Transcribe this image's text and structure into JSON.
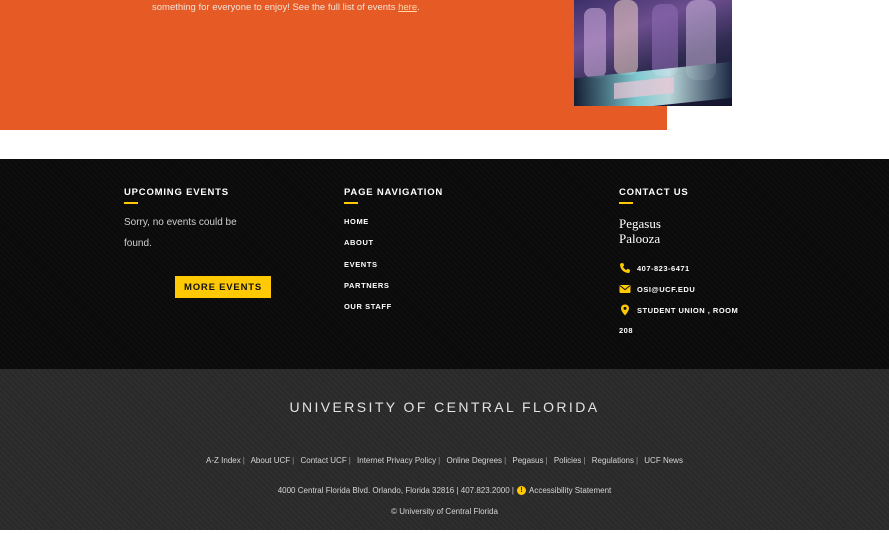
{
  "hero": {
    "text": "something for everyone to enjoy! See the full list of events ",
    "link_text": "here",
    "trailing": ".",
    "accent": "#e55a25"
  },
  "upcoming": {
    "heading": "UPCOMING EVENTS",
    "empty_text": "Sorry, no events could be found.",
    "button_label": "MORE EVENTS"
  },
  "page_nav": {
    "heading": "PAGE NAVIGATION",
    "items": [
      {
        "label": "HOME"
      },
      {
        "label": "ABOUT"
      },
      {
        "label": "EVENTS"
      },
      {
        "label": "PARTNERS"
      },
      {
        "label": "OUR STAFF"
      }
    ]
  },
  "contact": {
    "heading": "CONTACT US",
    "org_line1": "Pegasus",
    "org_line2": "Palooza",
    "phone": "407-823-6471",
    "email": "OSI@UCF.EDU",
    "address_line1": "STUDENT UNION , ROOM",
    "address_line2": "208",
    "icons": [
      "phone-icon",
      "envelope-icon",
      "map-pin-icon"
    ]
  },
  "university": {
    "name": "UNIVERSITY OF CENTRAL FLORIDA",
    "links": [
      {
        "label": "A-Z Index"
      },
      {
        "label": "About UCF"
      },
      {
        "label": "Contact UCF"
      },
      {
        "label": "Internet Privacy Policy"
      },
      {
        "label": "Online Degrees"
      },
      {
        "label": "Pegasus"
      },
      {
        "label": "Policies"
      },
      {
        "label": "Regulations"
      },
      {
        "label": "UCF News"
      }
    ],
    "address": "4000 Central Florida Blvd. Orlando, Florida 32816 | 407.823.2000 |",
    "accessibility": "Accessibility Statement",
    "copyright": "© University of Central Florida"
  },
  "colors": {
    "gold": "#ffc904",
    "dark_footer": "#0b0b0b",
    "bottom_footer": "#2a2a2a"
  }
}
